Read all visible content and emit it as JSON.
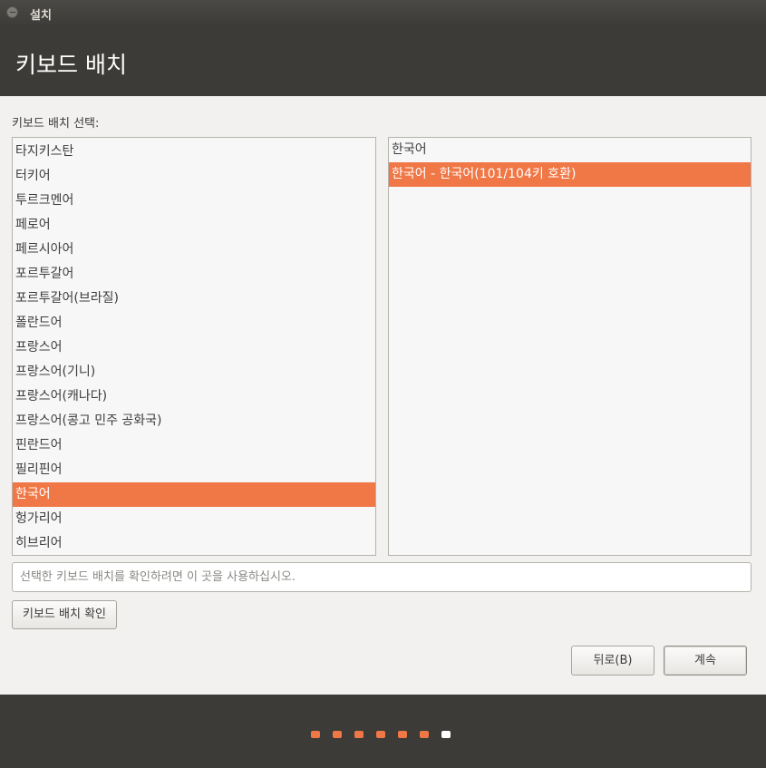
{
  "window": {
    "title": "설치"
  },
  "header": {
    "heading": "키보드 배치"
  },
  "layout_label": "키보드 배치 선택:",
  "layouts": [
    {
      "label": "타지키스탄",
      "selected": false
    },
    {
      "label": "터키어",
      "selected": false
    },
    {
      "label": "투르크멘어",
      "selected": false
    },
    {
      "label": "페로어",
      "selected": false
    },
    {
      "label": "페르시아어",
      "selected": false
    },
    {
      "label": "포르투갈어",
      "selected": false
    },
    {
      "label": "포르투갈어(브라질)",
      "selected": false
    },
    {
      "label": "폴란드어",
      "selected": false
    },
    {
      "label": "프랑스어",
      "selected": false
    },
    {
      "label": "프랑스어(기니)",
      "selected": false
    },
    {
      "label": "프랑스어(캐나다)",
      "selected": false
    },
    {
      "label": "프랑스어(콩고 민주 공화국)",
      "selected": false
    },
    {
      "label": "핀란드어",
      "selected": false
    },
    {
      "label": "필리핀어",
      "selected": false
    },
    {
      "label": "한국어",
      "selected": true
    },
    {
      "label": "헝가리어",
      "selected": false
    },
    {
      "label": "히브리어",
      "selected": false
    }
  ],
  "variants": [
    {
      "label": "한국어",
      "selected": false
    },
    {
      "label": "한국어 - 한국어(101/104키 호환)",
      "selected": true
    }
  ],
  "test_input": {
    "placeholder": "선택한 키보드 배치를 확인하려면 이 곳을 사용하십시오.",
    "value": ""
  },
  "buttons": {
    "detect": "키보드 배치 확인",
    "back": "뒤로(B)",
    "next": "계속"
  },
  "progress": {
    "total_steps": 7,
    "current_step": 7
  },
  "colors": {
    "accent": "#f07746",
    "dark": "#3c3b37",
    "dot_active": "#ffffff",
    "dot_done": "#f07746"
  }
}
